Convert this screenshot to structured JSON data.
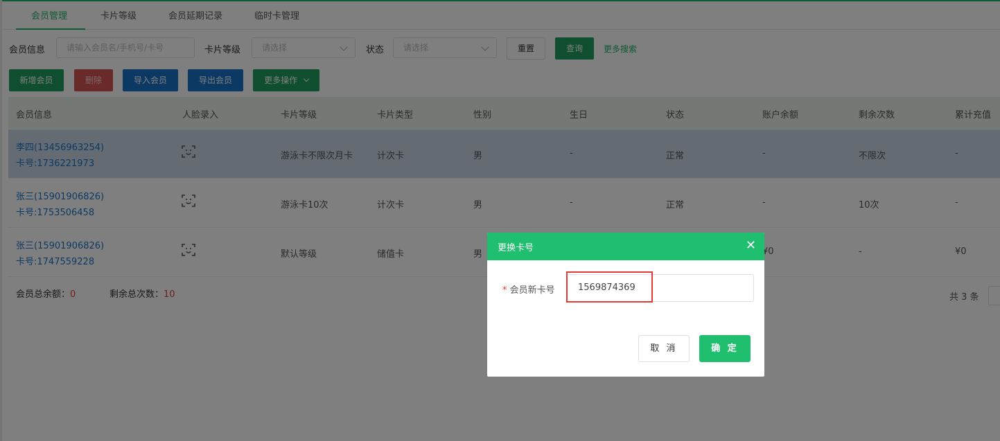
{
  "tabs": [
    "会员管理",
    "卡片等级",
    "会员延期记录",
    "临时卡管理"
  ],
  "filters": {
    "member_info_label": "会员信息",
    "member_info_placeholder": "请输入会员名/手机号/卡号",
    "card_level_label": "卡片等级",
    "card_level_placeholder": "请选择",
    "status_label": "状态",
    "status_placeholder": "请选择",
    "reset_label": "重置",
    "query_label": "查询",
    "more_search_label": "更多搜索"
  },
  "actions": {
    "add": "新增会员",
    "delete": "删除",
    "import": "导入会员",
    "export": "导出会员",
    "more": "更多操作"
  },
  "table": {
    "headers": [
      "会员信息",
      "人脸录入",
      "卡片等级",
      "卡片类型",
      "性别",
      "生日",
      "状态",
      "账户余额",
      "剩余次数",
      "累计充值"
    ],
    "rows": [
      {
        "name": "李四(13456963254)",
        "card_no": "卡号:1736221973",
        "level": "游泳卡不限次月卡",
        "type": "计次卡",
        "gender": "男",
        "birthday": "-",
        "status": "正常",
        "balance": "-",
        "remaining": "不限次",
        "recharge": "-"
      },
      {
        "name": "张三(15901906826)",
        "card_no": "卡号:1753506458",
        "level": "游泳卡10次",
        "type": "计次卡",
        "gender": "男",
        "birthday": "-",
        "status": "正常",
        "balance": "-",
        "remaining": "10次",
        "recharge": "-"
      },
      {
        "name": "张三(15901906826)",
        "card_no": "卡号:1747559228",
        "level": "默认等级",
        "type": "储值卡",
        "gender": "男",
        "birthday": "",
        "status": "",
        "balance": "¥0",
        "remaining": "-",
        "recharge": "¥0"
      }
    ]
  },
  "summary": {
    "balance_label": "会员总余额：",
    "balance_value": "0",
    "count_label": "剩余总次数：",
    "count_value": "10",
    "total": "共 3 条"
  },
  "dialog": {
    "title": "更换卡号",
    "required_mark": "*",
    "field_label": "会员新卡号",
    "field_value": "1569874369",
    "cancel_label": "取 消",
    "confirm_label": "确 定",
    "close_icon": "close-icon"
  },
  "colors": {
    "brand_green": "#20bf6f",
    "link_blue": "#1873c8",
    "danger_red": "#d75555",
    "highlight_red": "#e53935"
  }
}
